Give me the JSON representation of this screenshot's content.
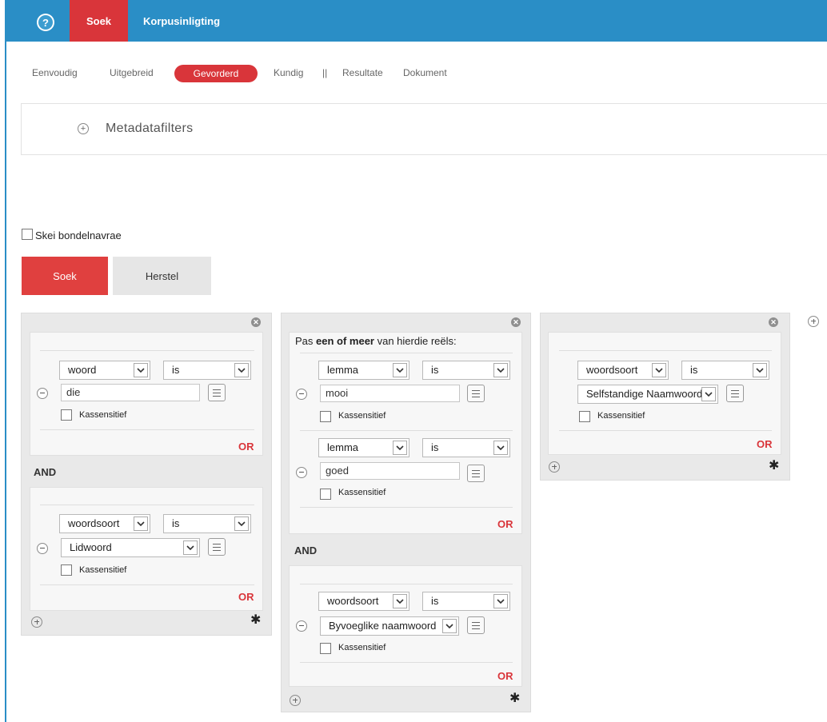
{
  "topbar": {
    "help_icon": "question-icon",
    "help_glyph": "?",
    "nav_search": "Soek",
    "nav_corpus_info": "Korpusinligting"
  },
  "subtabs": {
    "simple": "Eenvoudig",
    "extended": "Uitgebreid",
    "advanced": "Gevorderd",
    "expert": "Kundig",
    "separator": "||",
    "results": "Resultate",
    "document": "Dokument"
  },
  "metadata": {
    "label": "Metadatafilters"
  },
  "options": {
    "split_batch_label": "Skei bondelnavrae"
  },
  "buttons": {
    "search": "Soek",
    "reset": "Herstel"
  },
  "labels": {
    "case_sensitive": "Kassensitief",
    "or": "OR",
    "and": "AND",
    "pas_prefix": "Pas ",
    "pas_bold": "een of meer",
    "pas_suffix": " van hierdie reëls:"
  },
  "groups": [
    {
      "clauses": [
        {
          "attr": "woord",
          "op": "is",
          "value": "die"
        },
        {
          "attr": "woordsoort",
          "op": "is",
          "value": "Lidwoord"
        }
      ]
    },
    {
      "clauses": [
        {
          "attr": "lemma",
          "op": "is",
          "value": "mooi"
        },
        {
          "attr": "lemma",
          "op": "is",
          "value": "goed"
        },
        {
          "attr": "woordsoort",
          "op": "is",
          "value": "Byvoeglike naamwoord"
        }
      ]
    },
    {
      "clauses": [
        {
          "attr": "woordsoort",
          "op": "is",
          "value": "Selfstandige Naamwoord"
        }
      ]
    }
  ],
  "colors": {
    "brand_blue": "#2a8ec6",
    "accent_red": "#d9353a"
  }
}
